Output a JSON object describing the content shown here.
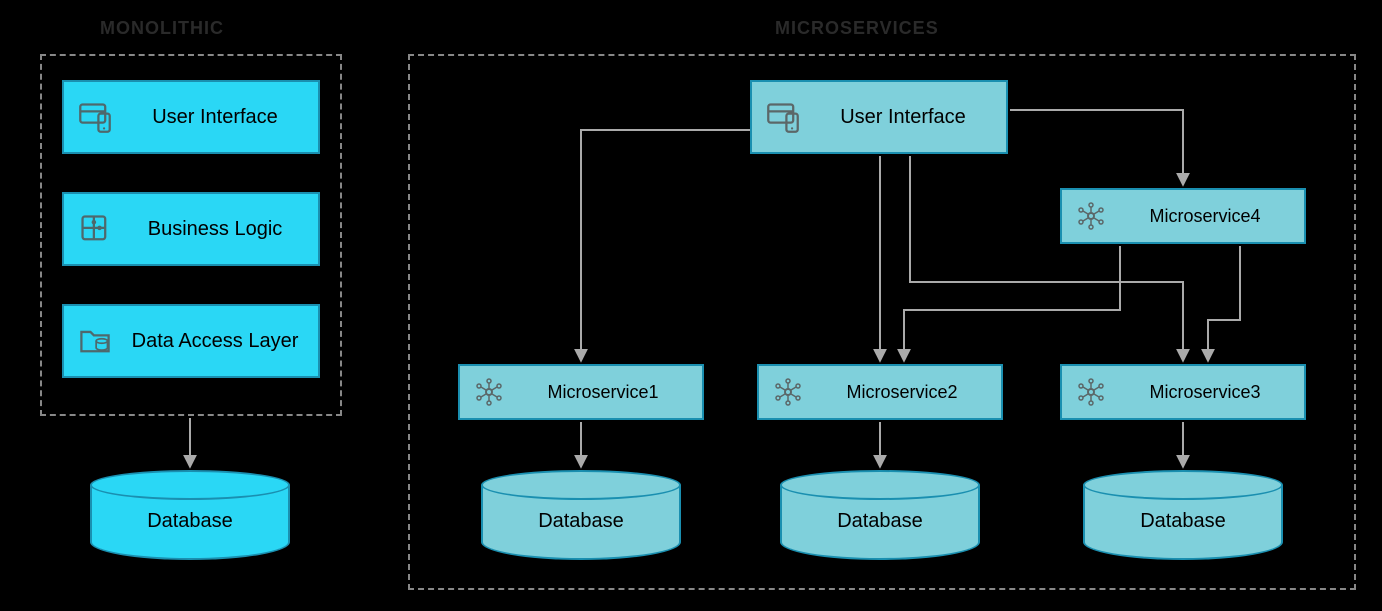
{
  "monolithic": {
    "title": "MONOLITHIC",
    "layers": [
      {
        "label": "User Interface",
        "icon": "ui"
      },
      {
        "label": "Business Logic",
        "icon": "puzzle"
      },
      {
        "label": "Data Access Layer",
        "icon": "folder-db"
      }
    ],
    "database_label": "Database"
  },
  "microservices": {
    "title": "MICROSERVICES",
    "user_interface_label": "User Interface",
    "services": [
      {
        "label": "Microservice1",
        "has_database": true,
        "database_label": "Database"
      },
      {
        "label": "Microservice2",
        "has_database": true,
        "database_label": "Database"
      },
      {
        "label": "Microservice3",
        "has_database": true,
        "database_label": "Database"
      },
      {
        "label": "Microservice4",
        "has_database": false
      }
    ],
    "connections": [
      {
        "from": "user_interface",
        "to": "Microservice1"
      },
      {
        "from": "user_interface",
        "to": "Microservice2"
      },
      {
        "from": "user_interface",
        "to": "Microservice3"
      },
      {
        "from": "user_interface",
        "to": "Microservice4"
      },
      {
        "from": "Microservice4",
        "to": "Microservice2"
      },
      {
        "from": "Microservice4",
        "to": "Microservice3"
      }
    ]
  },
  "colors": {
    "bright": "#2ad7f5",
    "muted": "#7fd0db",
    "border": "#1a8fb0",
    "arrow": "#aaaaaa",
    "dashed": "#888888"
  }
}
